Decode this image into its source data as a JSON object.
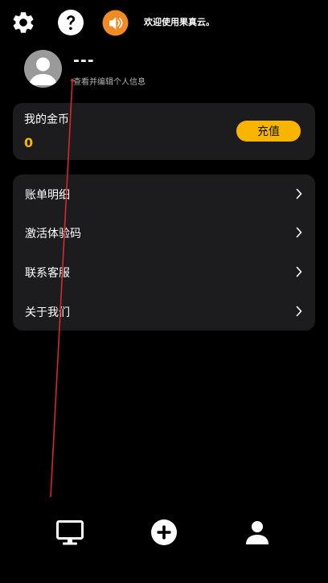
{
  "topbar": {
    "settings_icon": "gear-icon",
    "help_icon": "question-icon",
    "speaker_icon": "speaker-icon",
    "speaker_color": "#f08a24",
    "welcome_text": "欢迎使用果真云。"
  },
  "profile": {
    "avatar_icon": "avatar-icon",
    "username": "---",
    "hint": "查看并编辑个人信息"
  },
  "coins": {
    "title": "我的金币",
    "value": "0",
    "recharge_label": "充值",
    "accent_color": "#f7b500"
  },
  "menu": {
    "items": [
      {
        "label": "账单明细",
        "icon": "chevron-right-icon"
      },
      {
        "label": "激活体验码",
        "icon": "chevron-right-icon"
      },
      {
        "label": "联系客服",
        "icon": "chevron-right-icon"
      },
      {
        "label": "关于我们",
        "icon": "chevron-right-icon"
      }
    ]
  },
  "bottom_nav": {
    "items": [
      {
        "icon": "desktop-icon"
      },
      {
        "icon": "add-circle-icon"
      },
      {
        "icon": "user-icon"
      }
    ]
  }
}
